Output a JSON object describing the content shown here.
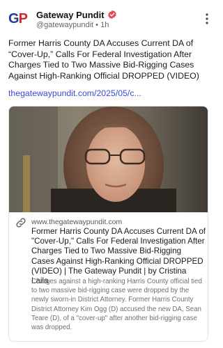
{
  "post": {
    "author": {
      "avatar_text_primary": "G",
      "avatar_text_secondary": "P",
      "name": "Gateway Pundit",
      "handle": "@gatewaypundit",
      "separator": "•",
      "time": "1h"
    },
    "headline": "Former Harris County DA Accuses Current DA of “Cover-Up,” Calls For Federal Investigation After Charges Tied to Two Massive Bid-Rigging Cases Against High-Ranking Official DROPPED (VIDEO)",
    "link_text": "thegatewaypundit.com/2025/05/c...",
    "card": {
      "domain": "www.thegatewaypundit.com",
      "title": "Former Harris County DA Accuses Current DA of \"Cover-Up,\" Calls For Federal Investigation After Charges Tied to Two Massive Bid-Rigging Cases Against High-Ranking Official DROPPED (VIDEO) | The Gateway Pundit | by Cristina Laila",
      "description": "Charges against a high-ranking Harris County official tied to two massive bid-rigging case were dropped by the newly sworn-in District Attorney. Former Harris County District Attorney Kim Ogg (D) accused the new DA, Sean Teare (D), of a \"cover-up\" after another bid-rigging case was dropped."
    }
  },
  "icons": {
    "verified": "verified-badge-icon",
    "more": "more-vertical-icon",
    "link": "link-icon"
  },
  "colors": {
    "link": "#3b49d6",
    "verified": "#e8495a",
    "avatar_blue": "#1f3f8f",
    "avatar_red": "#d0262f"
  }
}
